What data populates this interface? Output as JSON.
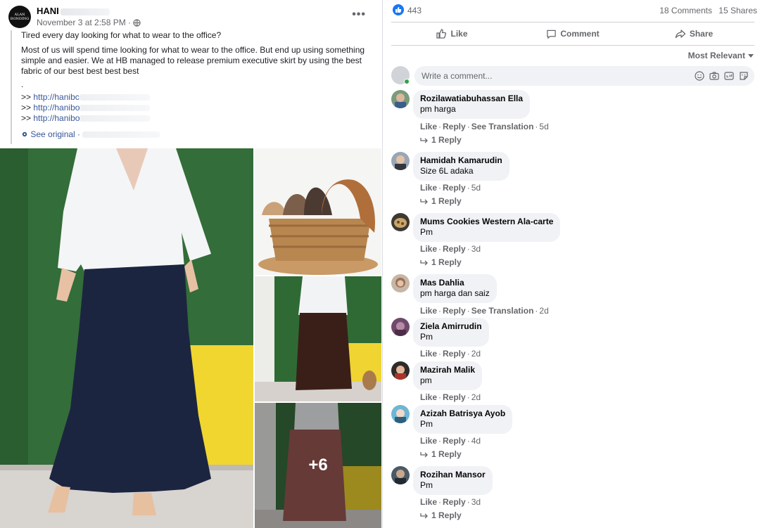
{
  "post": {
    "author": "HANI",
    "logo_text": "ALAN BONDING",
    "meta": "November 3 at 2:58 PM ·",
    "more_label": "•••",
    "headline": "Tired every day looking for what to wear to the office?",
    "paragraph": "Most of us will spend time looking for what to wear to the office. But end up using something simple and easier. We at HB managed to release premium executive skirt by using the best fabric of our best best best best",
    "dot": ".",
    "links": [
      {
        "prefix": ">>",
        "text": "http://hanibc"
      },
      {
        "prefix": ">>",
        "text": "http://hanibo"
      },
      {
        "prefix": ">>",
        "text": "http://hanibo"
      }
    ],
    "see_original": "See original ·",
    "more_photos": "+6"
  },
  "stats": {
    "likes": "443",
    "comments": "18 Comments",
    "shares": "15 Shares"
  },
  "actions": {
    "like": "Like",
    "comment": "Comment",
    "share": "Share"
  },
  "sort_label": "Most Relevant",
  "compose": {
    "placeholder": "Write a comment..."
  },
  "comments": [
    {
      "name": "Rozilawatiabuhassan Ella",
      "text": "pm harga",
      "like": "Like",
      "reply": "Reply",
      "translate": "See Translation",
      "time": "5d",
      "replies": "1 Reply"
    },
    {
      "name": "Hamidah Kamarudin",
      "text": "Size 6L adaka",
      "like": "Like",
      "reply": "Reply",
      "time": "5d",
      "replies": "1 Reply"
    },
    {
      "name": "Mums Cookies Western Ala-carte",
      "text": "Pm",
      "like": "Like",
      "reply": "Reply",
      "time": "3d",
      "replies": "1 Reply"
    },
    {
      "name": "Mas Dahlia",
      "text": "pm harga dan saiz",
      "like": "Like",
      "reply": "Reply",
      "translate": "See Translation",
      "time": "2d"
    },
    {
      "name": "Ziela Amirrudin",
      "text": "Pm",
      "like": "Like",
      "reply": "Reply",
      "time": "2d"
    },
    {
      "name": "Mazirah Malik",
      "text": "pm",
      "like": "Like",
      "reply": "Reply",
      "time": "2d"
    },
    {
      "name": "Azizah Batrisya Ayob",
      "text": "Pm",
      "like": "Like",
      "reply": "Reply",
      "time": "4d",
      "replies": "1 Reply"
    },
    {
      "name": "Rozihan Mansor",
      "text": "Pm",
      "like": "Like",
      "reply": "Reply",
      "time": "3d",
      "replies": "1 Reply"
    }
  ],
  "colors": {
    "link": "#385898",
    "fb_blue": "#1877f2",
    "bubble": "#f0f2f5",
    "muted": "#65676b"
  }
}
